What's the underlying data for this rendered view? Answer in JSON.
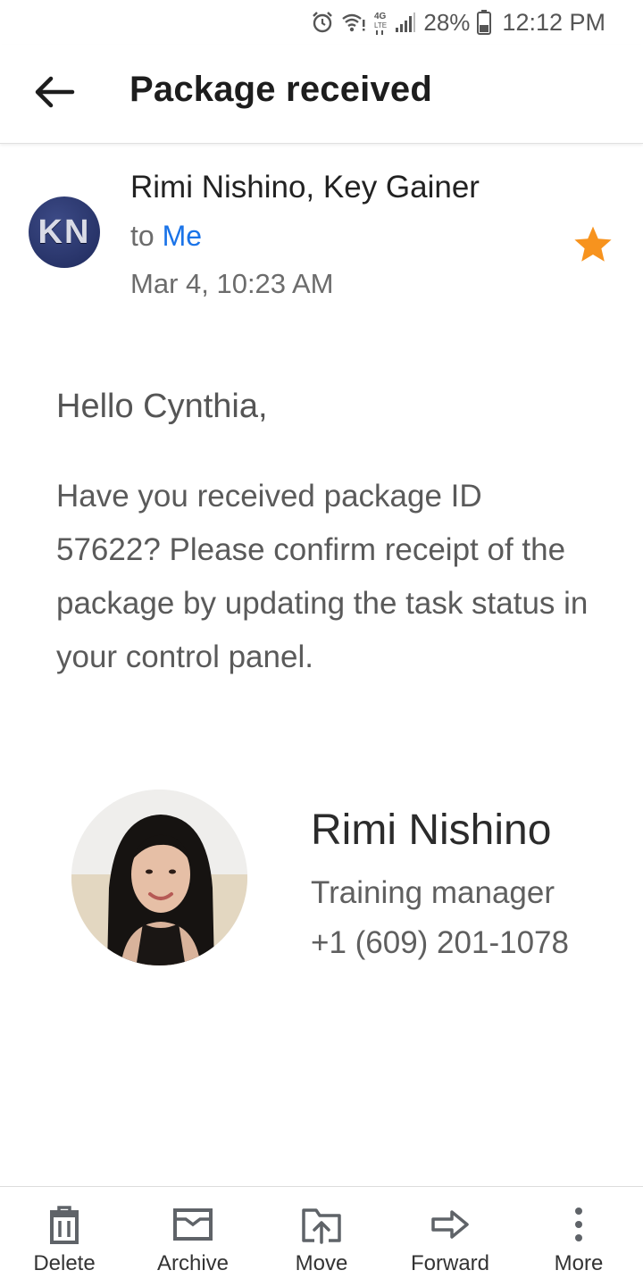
{
  "status_bar": {
    "battery_percent": "28%",
    "time": "12:12 PM",
    "icons": [
      "alarm-icon",
      "wifi-icon",
      "4g-lte-icon",
      "signal-icon",
      "battery-icon"
    ]
  },
  "app_bar": {
    "title": "Package received",
    "back_icon": "arrow-left-icon"
  },
  "email": {
    "avatar_initials": "KN",
    "sender": "Rimi Nishino, Key Gainer",
    "to_prefix": "to",
    "to_recipient": "Me",
    "date": "Mar 4, 10:23 AM",
    "starred": true,
    "star_color": "#f7931e",
    "greeting": "Hello Cynthia,",
    "body": "Have you received package ID 57622? Please confirm receipt of the package by updating the task status in your control panel."
  },
  "signature": {
    "name": "Rimi Nishino",
    "role": "Training manager",
    "phone": "+1 (609) 201-1078"
  },
  "toolbar": {
    "items": [
      {
        "label": "Delete",
        "icon": "trash-icon"
      },
      {
        "label": "Archive",
        "icon": "archive-icon"
      },
      {
        "label": "Move",
        "icon": "move-icon"
      },
      {
        "label": "Forward",
        "icon": "forward-icon"
      },
      {
        "label": "More",
        "icon": "more-vertical-icon"
      }
    ]
  },
  "colors": {
    "link": "#1a73e8",
    "icon": "#5f6368",
    "avatar_bg": "#27336b"
  }
}
